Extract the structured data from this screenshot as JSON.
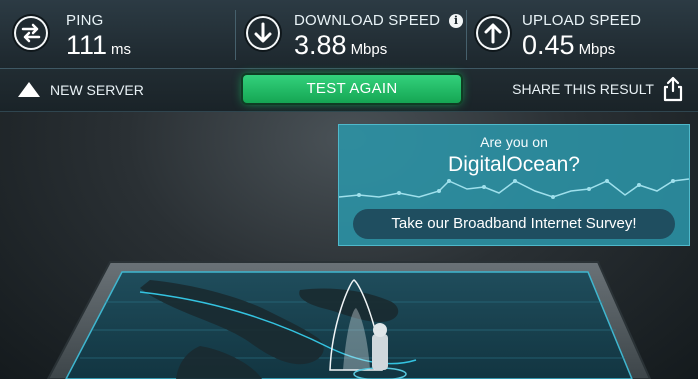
{
  "stats": {
    "ping": {
      "label": "PING",
      "value": "111",
      "unit": "ms",
      "icon": "ping-exchange-icon"
    },
    "download": {
      "label": "DOWNLOAD SPEED",
      "value": "3.88",
      "unit": "Mbps",
      "icon": "download-arrow-icon",
      "info": "i"
    },
    "upload": {
      "label": "UPLOAD SPEED",
      "value": "0.45",
      "unit": "Mbps",
      "icon": "upload-arrow-icon"
    }
  },
  "toolbar": {
    "new_server": "NEW SERVER",
    "test_again": "TEST AGAIN",
    "share": "SHARE THIS RESULT"
  },
  "survey": {
    "line1": "Are you on",
    "line2": "DigitalOcean?",
    "button": "Take our Broadband Internet Survey!"
  },
  "colors": {
    "accent_green": "#1ba55a",
    "panel_teal": "#2b94a7",
    "map_cyan": "#34c3e0"
  }
}
